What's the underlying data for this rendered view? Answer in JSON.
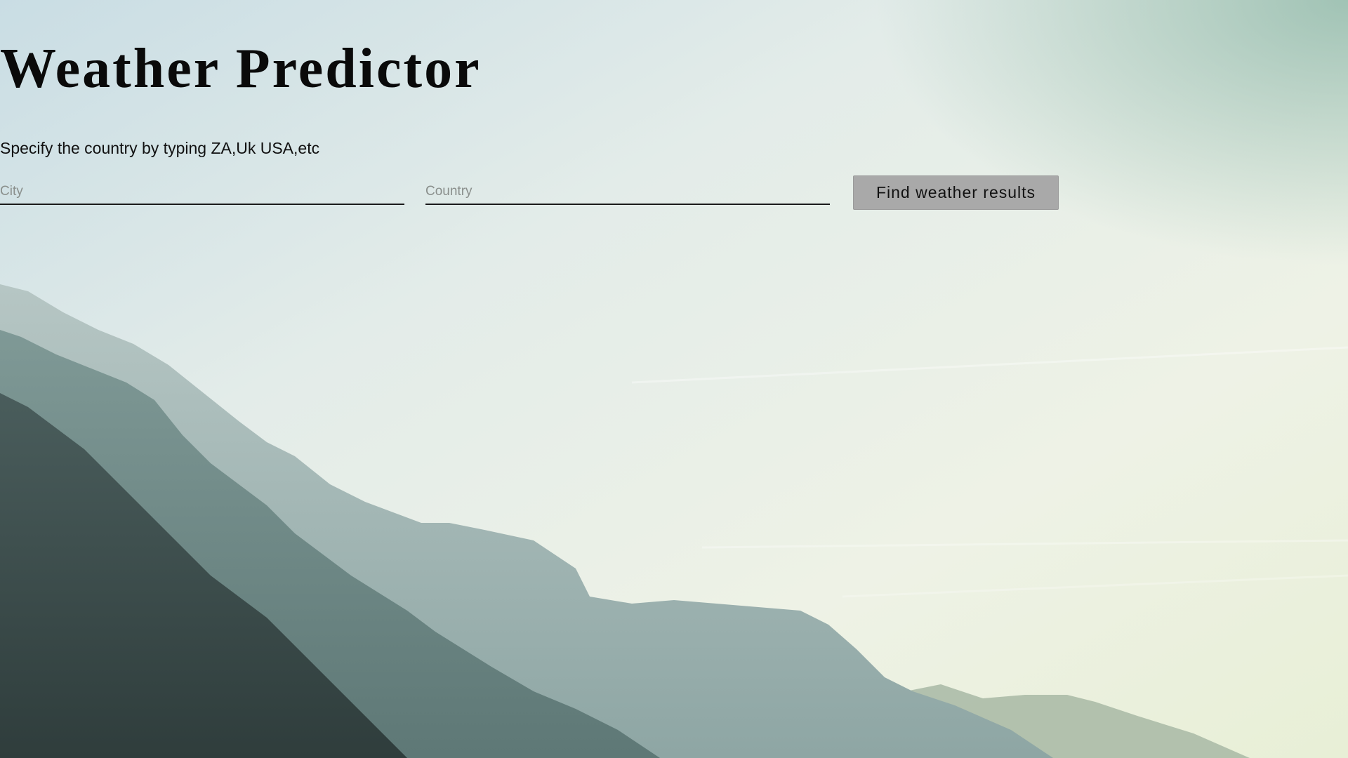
{
  "page": {
    "title": "Weather Predictor",
    "hint": "Specify the country by typing ZA,Uk USA,etc"
  },
  "form": {
    "city_placeholder": "City",
    "city_value": "",
    "country_placeholder": "Country",
    "country_value": "",
    "submit_label": "Find weather results"
  },
  "colors": {
    "sky_top": "#cfe0e6",
    "sky_bottom": "#f1f3e6",
    "mountain_far": "#9fb5b5",
    "mountain_mid": "#6d8886",
    "mountain_near": "#3d4f4e",
    "button_bg": "#a9a9a9"
  }
}
